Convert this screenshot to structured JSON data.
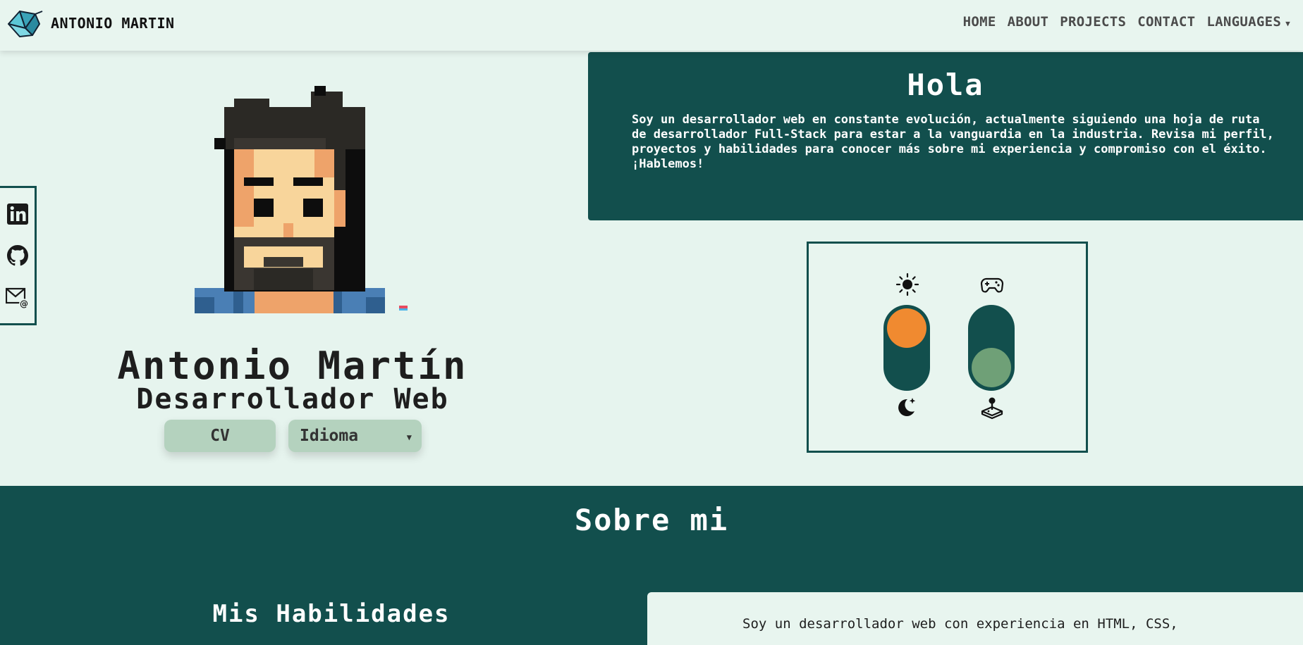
{
  "navbar": {
    "brand_name": "ANTONIO MARTIN",
    "logo_icon": "origami-crane-icon",
    "links": [
      {
        "label": "HOME"
      },
      {
        "label": "ABOUT"
      },
      {
        "label": "PROJECTS"
      },
      {
        "label": "CONTACT"
      },
      {
        "label": "LANGUAGES"
      }
    ]
  },
  "social": {
    "items": [
      {
        "name": "linkedin",
        "icon": "linkedin-icon"
      },
      {
        "name": "github",
        "icon": "github-icon"
      },
      {
        "name": "email",
        "icon": "email-icon"
      }
    ]
  },
  "hero": {
    "avatar": "pixel-art-avatar",
    "name": "Antonio Martín",
    "role": "Desarrollador Web",
    "cv_button": "CV",
    "language_button": "Idioma"
  },
  "intro": {
    "title": "Hola",
    "text": "Soy un desarrollador web en constante evolución, actualmente siguiendo una hoja de ruta de desarrollador Full-Stack para estar a la vanguardia en la industria. Revisa mi perfil, proyectos y habilidades para conocer más sobre mi experiencia y compromiso con el éxito. ¡Hablemos!"
  },
  "toggles": {
    "theme": {
      "top_icon": "sun-icon",
      "bottom_icon": "moon-stars-icon",
      "state": "light"
    },
    "game": {
      "top_icon": "gamepad-icon",
      "bottom_icon": "joystick-icon",
      "state": "off"
    }
  },
  "about": {
    "title": "Sobre mi",
    "skills_title": "Mis Habilidades",
    "text": "Soy un desarrollador web con experiencia en HTML, CSS,"
  },
  "colors": {
    "primary": "#124f4d",
    "background": "#e6f4ee",
    "button": "#b4d2be",
    "accent_orange": "#f08a30",
    "knob_green": "#6fa077"
  }
}
